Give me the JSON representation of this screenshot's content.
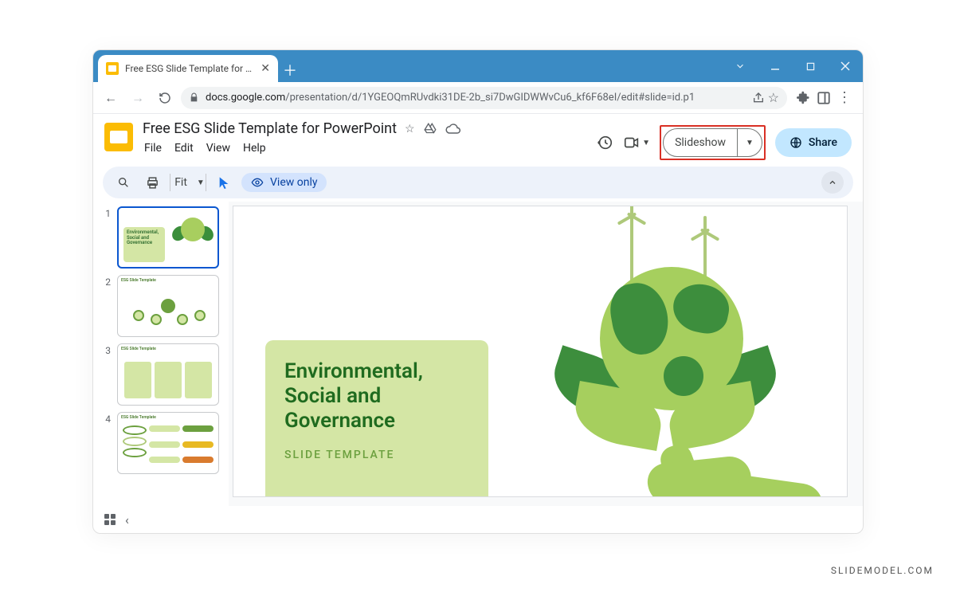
{
  "browser": {
    "tab_title": "Free ESG Slide Template for Pow",
    "url_host": "docs.google.com",
    "url_path": "/presentation/d/1YGEOQmRUvdki31DE-2b_si7DwGIDWWvCu6_kf6F68eI/edit#slide=id.p1"
  },
  "doc": {
    "title": "Free ESG Slide Template for PowerPoint",
    "menus": {
      "file": "File",
      "edit": "Edit",
      "view": "View",
      "help": "Help"
    },
    "slideshow_label": "Slideshow",
    "share_label": "Share"
  },
  "toolbar": {
    "zoom_label": "Fit",
    "view_only_label": "View only"
  },
  "slides": {
    "current": 1,
    "list": [
      {
        "num": "1"
      },
      {
        "num": "2",
        "heading": "ESG Slide Template"
      },
      {
        "num": "3",
        "heading": "ESG Slide Template"
      },
      {
        "num": "4",
        "heading": "ESG Slide Template"
      }
    ]
  },
  "main_slide": {
    "title": "Environmental, Social and Governance",
    "subtitle": "SLIDE TEMPLATE"
  },
  "thumb1": {
    "title": "Environmental, Social and Governance"
  },
  "watermark": "SLIDEMODEL.COM"
}
